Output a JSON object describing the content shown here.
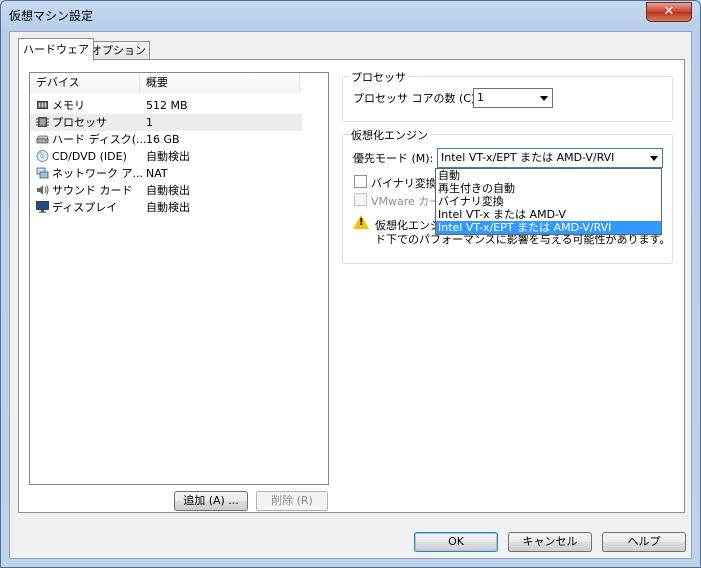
{
  "window": {
    "title": "仮想マシン設定",
    "close_glyph": "✕"
  },
  "tabs": [
    {
      "label": "ハードウェア"
    },
    {
      "label": "オプション"
    }
  ],
  "device_list": {
    "col_device": "デバイス",
    "col_summary": "概要",
    "rows": [
      {
        "name": "メモリ",
        "summary": "512 MB",
        "icon": "memory-icon"
      },
      {
        "name": "プロセッサ",
        "summary": "1",
        "icon": "processor-icon"
      },
      {
        "name": "ハード ディスク(...",
        "summary": "16 GB",
        "icon": "hard-disk-icon"
      },
      {
        "name": "CD/DVD (IDE)",
        "summary": "自動検出",
        "icon": "cd-dvd-icon"
      },
      {
        "name": "ネットワーク ア...",
        "summary": "NAT",
        "icon": "network-icon"
      },
      {
        "name": "サウンド カード",
        "summary": "自動検出",
        "icon": "sound-icon"
      },
      {
        "name": "ディスプレイ",
        "summary": "自動検出",
        "icon": "display-icon"
      }
    ]
  },
  "buttons": {
    "add": "追加 (A) ...",
    "remove": "削除 (R)",
    "ok": "OK",
    "cancel": "キャンセル",
    "help": "ヘルプ"
  },
  "processor_group": {
    "title": "プロセッサ",
    "cores_label": "プロセッサ コアの数 (C):",
    "cores_value": "1"
  },
  "virt_group": {
    "title": "仮想化エンジン",
    "mode_label": "優先モード (M):",
    "mode_value": "Intel VT-x/EPT または AMD-V/RVI",
    "binary_checkbox": "バイナリ変換の",
    "vmware_checkbox": "VMware カーネ",
    "warning_line1": "仮想化エンジ",
    "warning_line2": "ド下でのパフォーマンスに影響を与える可能性があります。"
  },
  "dropdown_options": [
    "自動",
    "再生付きの自動",
    "バイナリ変換",
    "Intel VT-x または AMD-V",
    "Intel VT-x/EPT または AMD-V/RVI"
  ],
  "dropdown_selected_index": 4
}
